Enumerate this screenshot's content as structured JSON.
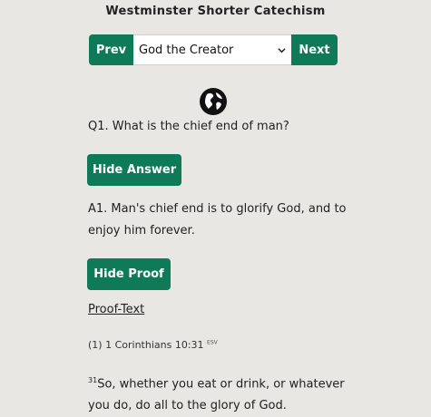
{
  "header": {
    "title": "Westminster Shorter Catechism"
  },
  "nav": {
    "prev_label": "Prev",
    "next_label": "Next",
    "selected_topic": "God the Creator"
  },
  "icon": "globe-icon",
  "colors": {
    "accent": "#0e7a57",
    "background": "#e9e7e3"
  },
  "question": {
    "text": "Q1. What is the chief end of man?"
  },
  "answer": {
    "toggle_label": "Hide Answer",
    "text": "A1. Man's chief end is to glorify God, and to enjoy him forever."
  },
  "proof": {
    "toggle_label": "Hide Proof",
    "heading": "Proof-Text",
    "reference_number": "(1)",
    "reference": "1 Corinthians 10:31",
    "version": "ESV",
    "verse_number": "31",
    "verse_text": "So, whether you eat or drink, or whatever you do, do all to the glory of God."
  }
}
